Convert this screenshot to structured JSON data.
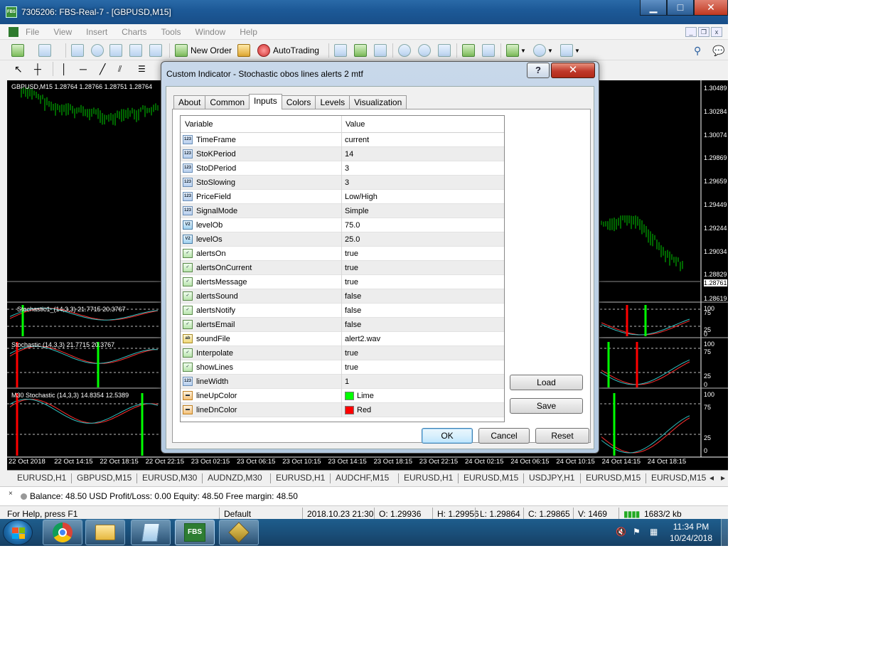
{
  "window": {
    "title": "7305206: FBS-Real-7 - [GBPUSD,M15]",
    "app_icon_text": "FBS",
    "minimize": "▁",
    "maximize": "□",
    "close": "✕"
  },
  "menu": {
    "items": [
      "File",
      "View",
      "Insert",
      "Charts",
      "Tools",
      "Window",
      "Help"
    ]
  },
  "toolbar": {
    "new_order": "New Order",
    "auto_trading": "AutoTrading"
  },
  "chart": {
    "title": "GBPUSD,M15  1.28764 1.28766 1.28751 1.28764",
    "price_labels": [
      "1.30489",
      "1.30284",
      "1.30074",
      "1.29869",
      "1.29659",
      "1.29449",
      "1.29244",
      "1.29034",
      "1.28829",
      "1.28761",
      "1.28619"
    ],
    "time_labels": [
      "22 Oct 2018",
      "22 Oct 14:15",
      "22 Oct 18:15",
      "22 Oct 22:15",
      "23 Oct 02:15",
      "23 Oct 06:15",
      "23 Oct 10:15",
      "23 Oct 14:15",
      "23 Oct 18:15",
      "23 Oct 22:15",
      "24 Oct 02:15",
      "24 Oct 06:15",
      "24 Oct 10:15",
      "24 Oct 14:15",
      "24 Oct 18:15"
    ],
    "sub1_label": "Stochastic1_(14,3,3) 21.7715 20.3767",
    "sub2_label": "Stochastic (14,3,3) 21.7715 20.3767",
    "sub3_label": "M30 Stochastic (14,3,3) 14.8354 12.5389",
    "sub1_levels": [
      "100",
      "75",
      "25",
      "0"
    ],
    "sub2_levels": [
      "100",
      "75",
      "25",
      "0"
    ],
    "sub3_levels": [
      "100",
      "75",
      "25",
      "0"
    ],
    "colors": {
      "bull": "#00cc00",
      "stoch_main": "#ff3030",
      "stoch_signal": "#30c0c0",
      "line_up": "#00ff00",
      "line_dn": "#ff0000"
    }
  },
  "symbol_tabs": [
    "EURUSD,H1",
    "GBPUSD,M15",
    "EURUSD,M30",
    "AUDNZD,M30",
    "EURUSD,H1",
    "AUDCHF,M15",
    "EURUSD,H1",
    "EURUSD,M15",
    "USDJPY,H1",
    "EURUSD,M15",
    "EURUSD,M15"
  ],
  "terminal": {
    "close": "×",
    "balance_text": "Balance: 48.50 USD  Profit/Loss: 0.00  Equity: 48.50  Free margin: 48.50"
  },
  "status": {
    "help": "For Help, press F1",
    "profile": "Default",
    "datetime": "2018.10.23 21:30",
    "open": "O: 1.29936",
    "high": "H: 1.29956",
    "low": "L: 1.29864",
    "close": "C: 1.29865",
    "volume": "V: 1469",
    "traffic": "1683/2 kb"
  },
  "taskbar": {
    "clock_time": "11:34 PM",
    "clock_date": "10/24/2018",
    "fbs_label": "FBS"
  },
  "dialog": {
    "title": "Custom Indicator - Stochastic obos lines alerts 2 mtf",
    "help_label": "?",
    "close_label": "✕",
    "tabs": [
      "About",
      "Common",
      "Inputs",
      "Colors",
      "Levels",
      "Visualization"
    ],
    "active_tab": "Inputs",
    "columns": {
      "variable": "Variable",
      "value": "Value"
    },
    "params": [
      {
        "type": "123",
        "name": "TimeFrame",
        "value": "current"
      },
      {
        "type": "123",
        "name": "StoKPeriod",
        "value": "14"
      },
      {
        "type": "123",
        "name": "StoDPeriod",
        "value": "3"
      },
      {
        "type": "123",
        "name": "StoSlowing",
        "value": "3"
      },
      {
        "type": "123",
        "name": "PriceField",
        "value": "Low/High"
      },
      {
        "type": "123",
        "name": "SignalMode",
        "value": "Simple"
      },
      {
        "type": "v2",
        "name": "levelOb",
        "value": "75.0"
      },
      {
        "type": "v2",
        "name": "levelOs",
        "value": "25.0"
      },
      {
        "type": "bool",
        "name": "alertsOn",
        "value": "true"
      },
      {
        "type": "bool",
        "name": "alertsOnCurrent",
        "value": "true"
      },
      {
        "type": "bool",
        "name": "alertsMessage",
        "value": "true"
      },
      {
        "type": "bool",
        "name": "alertsSound",
        "value": "false"
      },
      {
        "type": "bool",
        "name": "alertsNotify",
        "value": "false"
      },
      {
        "type": "bool",
        "name": "alertsEmail",
        "value": "false"
      },
      {
        "type": "ab",
        "name": "soundFile",
        "value": "alert2.wav"
      },
      {
        "type": "bool",
        "name": "Interpolate",
        "value": "true"
      },
      {
        "type": "bool",
        "name": "showLines",
        "value": "true"
      },
      {
        "type": "123",
        "name": "lineWidth",
        "value": "1"
      },
      {
        "type": "color",
        "name": "lineUpColor",
        "value": "Lime",
        "color": "#00ff00"
      },
      {
        "type": "color",
        "name": "lineDnColor",
        "value": "Red",
        "color": "#ff0000"
      }
    ],
    "buttons": {
      "load": "Load",
      "save": "Save",
      "ok": "OK",
      "cancel": "Cancel",
      "reset": "Reset"
    }
  }
}
